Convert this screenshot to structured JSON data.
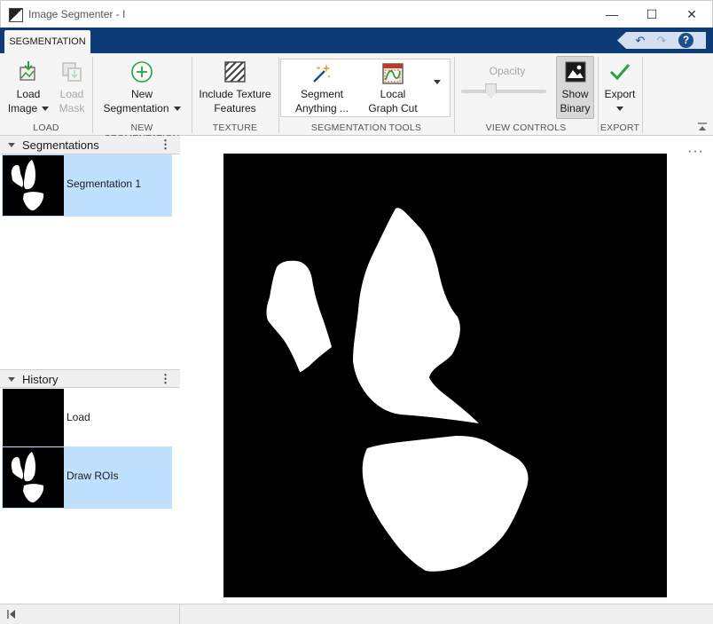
{
  "window": {
    "title": "Image Segmenter - I",
    "controls": {
      "minimize": "—",
      "maximize": "☐",
      "close": "✕"
    }
  },
  "ribbon": {
    "active_tab": "SEGMENTATION",
    "quick_access": {
      "undo": "↶",
      "redo": "↷",
      "help": "?"
    }
  },
  "toolstrip": {
    "load": {
      "load_image": {
        "line1": "Load",
        "line2": "Image"
      },
      "load_mask": {
        "line1": "Load",
        "line2": "Mask"
      },
      "section": "LOAD"
    },
    "new_segmentation": {
      "button": {
        "line1": "New",
        "line2": "Segmentation"
      },
      "section": "NEW SEGMENTATION"
    },
    "texture": {
      "button": {
        "line1": "Include Texture",
        "line2": "Features"
      },
      "section": "TEXTURE"
    },
    "segmentation_tools": {
      "segment_anything": {
        "line1": "Segment",
        "line2": "Anything ..."
      },
      "local_graph_cut": {
        "line1": "Local",
        "line2": "Graph Cut"
      },
      "section": "SEGMENTATION TOOLS"
    },
    "view_controls": {
      "opacity_label": "Opacity",
      "opacity_level": 0.35,
      "show_binary": {
        "line1": "Show",
        "line2": "Binary"
      },
      "section": "VIEW CONTROLS"
    },
    "export": {
      "button": {
        "line1": "Export"
      },
      "section": "EXPORT"
    }
  },
  "segmentations_panel": {
    "title": "Segmentations",
    "items": [
      {
        "label": "Segmentation 1",
        "selected": true
      }
    ]
  },
  "history_panel": {
    "title": "History",
    "items": [
      {
        "label": "Load",
        "selected": false
      },
      {
        "label": "Draw ROIs",
        "selected": true
      }
    ]
  },
  "colors": {
    "ribbon_blue": "#0e3c78",
    "selection": "#bfe1ff",
    "accent_green": "#2e9e3e"
  }
}
